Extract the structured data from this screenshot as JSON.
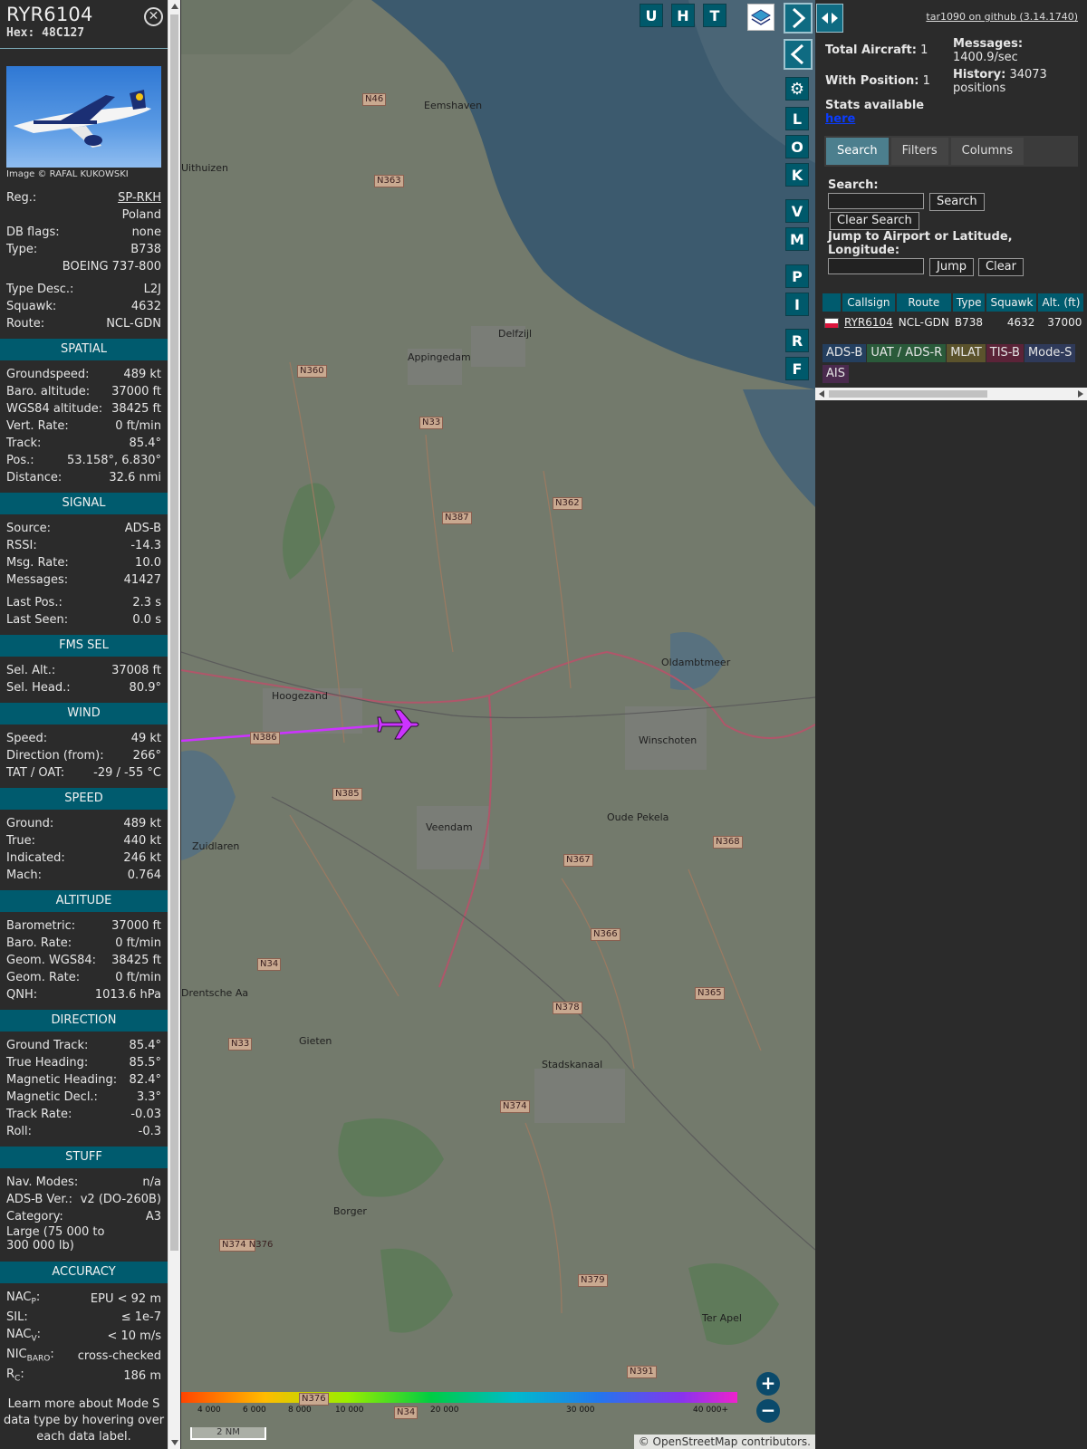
{
  "aircraft": {
    "callsign": "RYR6104",
    "hex_label": "Hex:",
    "hex": "48C127",
    "image_credit": "Image © RAFAL KUKOWSKI"
  },
  "details": {
    "reg_label": "Reg.:",
    "reg": "SP-RKH",
    "country": "Poland",
    "dbflags_label": "DB flags:",
    "dbflags": "none",
    "type_label": "Type:",
    "type": "B738",
    "type_full": "BOEING 737-800",
    "typedesc_label": "Type Desc.:",
    "typedesc": "L2J",
    "squawk_label": "Squawk:",
    "squawk": "4632",
    "route_label": "Route:",
    "route": "NCL-GDN"
  },
  "spatial": {
    "title": "SPATIAL",
    "rows": [
      {
        "k": "Groundspeed:",
        "v": "489 kt"
      },
      {
        "k": "Baro. altitude:",
        "v": "37000 ft"
      },
      {
        "k": "WGS84 altitude:",
        "v": "38425 ft"
      },
      {
        "k": "Vert. Rate:",
        "v": "0 ft/min"
      },
      {
        "k": "Track:",
        "v": "85.4°"
      },
      {
        "k": "Pos.:",
        "v": "53.158°, 6.830°"
      },
      {
        "k": "Distance:",
        "v": "32.6 nmi"
      }
    ]
  },
  "signal": {
    "title": "SIGNAL",
    "rows": [
      {
        "k": "Source:",
        "v": "ADS-B"
      },
      {
        "k": "RSSI:",
        "v": "-14.3"
      },
      {
        "k": "Msg. Rate:",
        "v": "10.0"
      },
      {
        "k": "Messages:",
        "v": "41427"
      }
    ],
    "rows2": [
      {
        "k": "Last Pos.:",
        "v": "2.3 s"
      },
      {
        "k": "Last Seen:",
        "v": "0.0 s"
      }
    ]
  },
  "fms": {
    "title": "FMS SEL",
    "rows": [
      {
        "k": "Sel. Alt.:",
        "v": "37008 ft"
      },
      {
        "k": "Sel. Head.:",
        "v": "80.9°"
      }
    ]
  },
  "wind": {
    "title": "WIND",
    "rows": [
      {
        "k": "Speed:",
        "v": "49 kt"
      },
      {
        "k": "Direction (from):",
        "v": "266°"
      },
      {
        "k": "TAT / OAT:",
        "v": "-29 / -55 °C"
      }
    ]
  },
  "speed": {
    "title": "SPEED",
    "rows": [
      {
        "k": "Ground:",
        "v": "489 kt"
      },
      {
        "k": "True:",
        "v": "440 kt"
      },
      {
        "k": "Indicated:",
        "v": "246 kt"
      },
      {
        "k": "Mach:",
        "v": "0.764"
      }
    ]
  },
  "altitude": {
    "title": "ALTITUDE",
    "rows": [
      {
        "k": "Barometric:",
        "v": "37000 ft"
      },
      {
        "k": "Baro. Rate:",
        "v": "0 ft/min"
      },
      {
        "k": "Geom. WGS84:",
        "v": "38425 ft"
      },
      {
        "k": "Geom. Rate:",
        "v": "0 ft/min"
      },
      {
        "k": "QNH:",
        "v": "1013.6 hPa"
      }
    ]
  },
  "direction": {
    "title": "DIRECTION",
    "rows": [
      {
        "k": "Ground Track:",
        "v": "85.4°"
      },
      {
        "k": "True Heading:",
        "v": "85.5°"
      },
      {
        "k": "Magnetic Heading:",
        "v": "82.4°"
      },
      {
        "k": "Magnetic Decl.:",
        "v": "3.3°"
      },
      {
        "k": "Track Rate:",
        "v": "-0.03"
      },
      {
        "k": "Roll:",
        "v": "-0.3"
      }
    ]
  },
  "stuff": {
    "title": "STUFF",
    "rows": [
      {
        "k": "Nav. Modes:",
        "v": "n/a"
      },
      {
        "k": "ADS-B Ver.:",
        "v": "v2 (DO-260B)"
      },
      {
        "k": "Category:",
        "v": "A3"
      }
    ],
    "category_desc": "Large (75 000 to 300 000 lb)"
  },
  "accuracy": {
    "title": "ACCURACY",
    "nacp_k": "NAC",
    "nacp_sub": "P",
    "nacp_v": "EPU < 92 m",
    "sil_k": "SIL:",
    "sil_v": "≤ 1e-7",
    "nacv_k": "NAC",
    "nacv_sub": "V",
    "nacv_v": "< 10 m/s",
    "nicbaro_k": "NIC",
    "nicbaro_sub": "BARO",
    "nicbaro_v": "cross-checked",
    "rc_k": "R",
    "rc_sub": "C",
    "rc_v": "186 m"
  },
  "learn_more": "Learn more about Mode S data type by hovering over each data label.",
  "map": {
    "layer_buttons": [
      "U",
      "H",
      "T"
    ],
    "side_buttons": [
      "L",
      "O",
      "K",
      "V",
      "M",
      "P",
      "I",
      "R",
      "F"
    ],
    "places": [
      {
        "name": "Delfzijl"
      },
      {
        "name": "Appingedam"
      },
      {
        "name": "Hoogezand"
      },
      {
        "name": "Winschoten"
      },
      {
        "name": "Veendam"
      },
      {
        "name": "Oude Pekela"
      },
      {
        "name": "Zuidlaren"
      },
      {
        "name": "Gieten"
      },
      {
        "name": "Stadskanaal"
      },
      {
        "name": "Borger"
      },
      {
        "name": "Ter Apel"
      },
      {
        "name": "Eemshaven"
      },
      {
        "name": "Uithuizen"
      },
      {
        "name": "Oldambtmeer"
      },
      {
        "name": "Drentsche Aa"
      }
    ],
    "roads": [
      "N46",
      "N363",
      "N360",
      "N33",
      "N387",
      "N362",
      "N386",
      "N385",
      "N367",
      "N368",
      "N366",
      "N34",
      "N33",
      "N378",
      "N365",
      "N374",
      "N374 N376",
      "N379",
      "N391",
      "N34",
      "N376"
    ],
    "altitude_scale": [
      "4 000",
      "6 000",
      "8 000",
      "10 000",
      "20 000",
      "30 000",
      "40 000+"
    ],
    "scale_label": "2 NM",
    "attribution": "© OpenStreetMap contributors.",
    "zoom_in": "+",
    "zoom_out": "−"
  },
  "right": {
    "github": "tar1090 on github (3.14.1740)",
    "total_aircraft_label": "Total Aircraft:",
    "total_aircraft": "1",
    "with_position_label": "With Position:",
    "with_position": "1",
    "messages_label": "Messages:",
    "messages": "1400.9/sec",
    "history_label": "History:",
    "history": "34073 positions",
    "stats_label": "Stats available",
    "stats_link": "here",
    "tabs": [
      "Search",
      "Filters",
      "Columns"
    ],
    "search_label": "Search:",
    "search_button": "Search",
    "clear_search_button": "Clear Search",
    "jump_label": "Jump to Airport or Latitude, Longitude:",
    "jump_button": "Jump",
    "clear_button": "Clear",
    "columns": [
      "",
      "Callsign",
      "Route",
      "Type",
      "Squawk",
      "Alt. (ft)"
    ],
    "rows": [
      {
        "callsign": "RYR6104",
        "route": "NCL-GDN",
        "type": "B738",
        "squawk": "4632",
        "alt": "37000"
      }
    ],
    "source_tags": [
      {
        "label": "ADS-B",
        "color": "#243f5f"
      },
      {
        "label": "UAT / ADS-R",
        "color": "#2a5a3a"
      },
      {
        "label": "MLAT",
        "color": "#5b532c"
      },
      {
        "label": "TIS-B",
        "color": "#5b2338"
      },
      {
        "label": "Mode-S",
        "color": "#2f3a5a"
      },
      {
        "label": "AIS",
        "color": "#4a2a4e"
      }
    ]
  },
  "colors": {
    "section": "#005b6e",
    "panel": "#2b2b2b",
    "trail": "#cc33ff",
    "aircraft": "#cc33ff"
  }
}
